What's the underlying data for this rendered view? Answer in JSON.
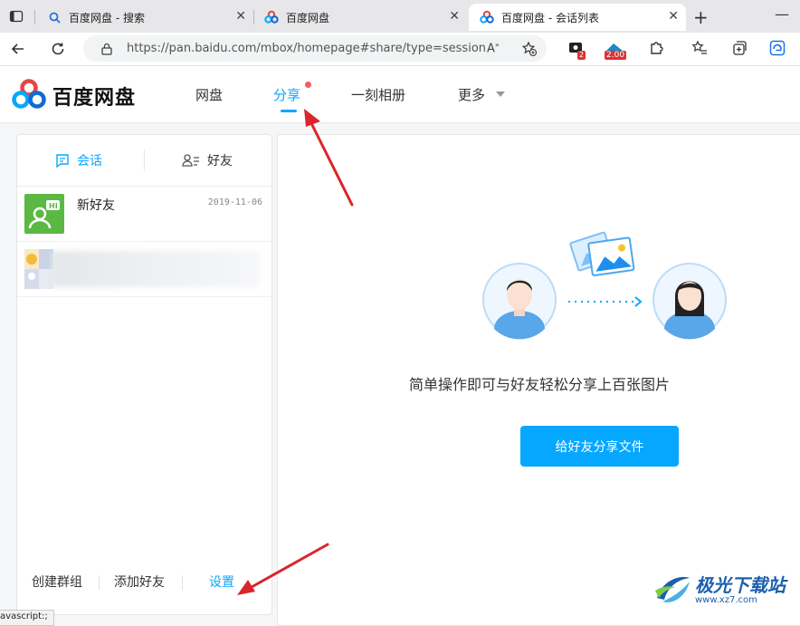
{
  "browser": {
    "tabs": [
      {
        "title": "百度网盘 - 搜索",
        "icon": "search-icon"
      },
      {
        "title": "百度网盘",
        "icon": "baidu-pan-icon"
      },
      {
        "title": "百度网盘 - 会话列表",
        "icon": "baidu-pan-icon",
        "active": true
      }
    ],
    "url": "https://pan.baidu.com/mbox/homepage#share/type=session",
    "extension_badges": [
      "2",
      "2.00"
    ]
  },
  "header": {
    "logo_text": "百度网盘",
    "nav": [
      "网盘",
      "分享",
      "一刻相册",
      "更多"
    ],
    "active_nav": "分享"
  },
  "sidebar": {
    "tabs": [
      "会话",
      "好友"
    ],
    "conversations": [
      {
        "name": "新好友",
        "date": "2019-11-06"
      },
      {
        "name": "",
        "date": ""
      }
    ],
    "footer": [
      "创建群组",
      "添加好友",
      "设置"
    ]
  },
  "main": {
    "description": "简单操作即可与好友轻松分享上百张图片",
    "share_button": "给好友分享文件"
  },
  "status_text": "avascript:;",
  "watermark": {
    "main": "极光下载站",
    "sub": "www.xz7.com"
  },
  "colors": {
    "accent": "#06a7ff",
    "arrow": "#d9262a",
    "notice_dot": "#f25d5d"
  }
}
